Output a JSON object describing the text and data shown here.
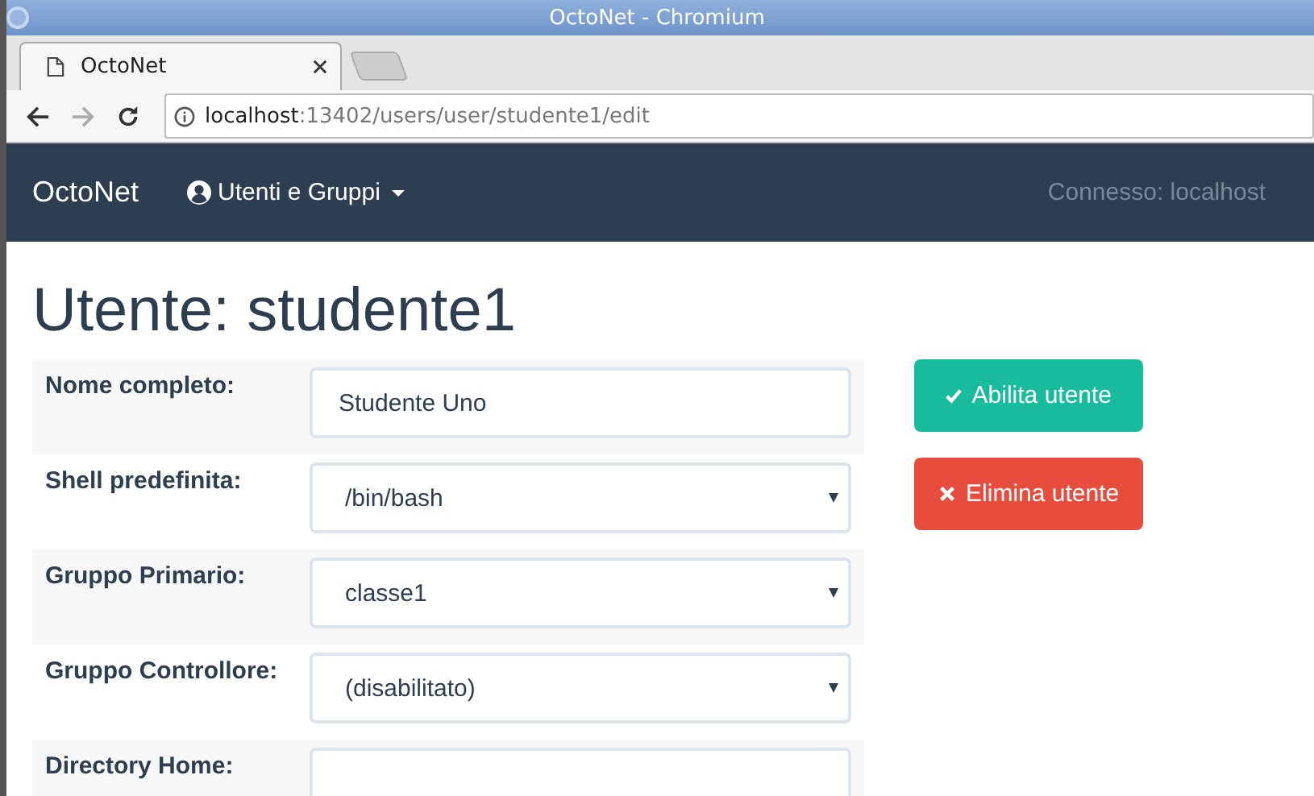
{
  "window": {
    "title": "OctoNet - Chromium"
  },
  "tabs": [
    {
      "label": "OctoNet",
      "selected": true
    }
  ],
  "address_bar": {
    "host": "localhost",
    "path": ":13402/users/user/studente1/edit"
  },
  "navbar": {
    "brand": "OctoNet",
    "menu": "Utenti e Gruppi",
    "status": "Connesso: localhost"
  },
  "page": {
    "heading": "Utente: studente1"
  },
  "form": [
    {
      "kind": "text",
      "label": "Nome completo:",
      "value": "Studente Uno"
    },
    {
      "kind": "select",
      "label": "Shell predefinita:",
      "value": "/bin/bash"
    },
    {
      "kind": "select",
      "label": "Gruppo Primario:",
      "value": "classe1"
    },
    {
      "kind": "select",
      "label": "Gruppo Controllore:",
      "value": "(disabilitato)"
    },
    {
      "kind": "text",
      "label": "Directory Home:"
    }
  ],
  "buttons": [
    {
      "kind": "success",
      "label": "Abilita utente"
    },
    {
      "kind": "danger",
      "label": "Elimina utente"
    }
  ]
}
